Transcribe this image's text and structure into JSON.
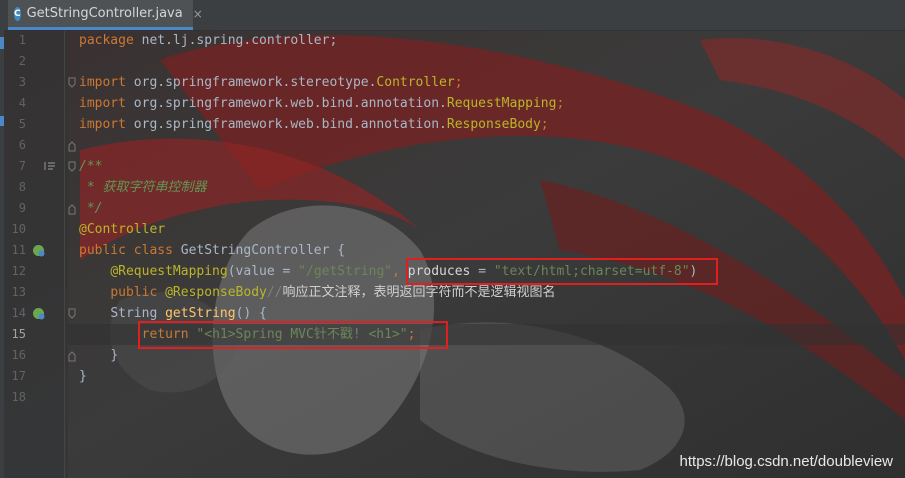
{
  "tab": {
    "icon": "C",
    "title": "GetStringController.java",
    "close": "×"
  },
  "lines": [
    {
      "n": "1"
    },
    {
      "n": "2"
    },
    {
      "n": "3"
    },
    {
      "n": "4"
    },
    {
      "n": "5"
    },
    {
      "n": "6"
    },
    {
      "n": "7"
    },
    {
      "n": "8"
    },
    {
      "n": "9"
    },
    {
      "n": "10"
    },
    {
      "n": "11"
    },
    {
      "n": "12"
    },
    {
      "n": "13"
    },
    {
      "n": "14"
    },
    {
      "n": "15"
    },
    {
      "n": "16"
    },
    {
      "n": "17"
    },
    {
      "n": "18"
    }
  ],
  "code": {
    "l1": {
      "kw": "package",
      "rest": " net.lj.spring.controller;"
    },
    "l3": {
      "kw": "import",
      "pkg": " org.springframework.stereotype.",
      "cls": "Controller",
      "semi": ";"
    },
    "l4": {
      "kw": "import",
      "pkg": " org.springframework.web.bind.annotation.",
      "cls": "RequestMapping",
      "semi": ";"
    },
    "l5": {
      "kw": "import",
      "pkg": " org.springframework.web.bind.annotation.",
      "cls": "ResponseBody",
      "semi": ";"
    },
    "l7": {
      "c": "/**"
    },
    "l8": {
      "c": " * 获取字符串控制器"
    },
    "l9": {
      "c": " */"
    },
    "l10": {
      "ann": "@Controller"
    },
    "l11": {
      "kw": "public class",
      "rest": " GetStringController {"
    },
    "l12": {
      "ann": "@RequestMapping",
      "p1": "(value = ",
      "s1": "\"/getString\"",
      "p2": ",",
      "p3": "produces",
      "p4": " = ",
      "s2": "\"text/html;charset=utf-8\"",
      "p5": ")"
    },
    "l13": {
      "kw": "public",
      "sp": " ",
      "ann": "@ResponseBody",
      "lc": "//",
      "cjk": "响应正文注释，表明返回字符而不是逻辑视图名"
    },
    "l14": {
      "type": "String",
      "sp": " ",
      "fn": "getString",
      "rest": "() {"
    },
    "l15": {
      "kw": "return",
      "sp": " ",
      "s": "\"<h1>Spring MVC针不戳! <h1>\"",
      "semi": ";"
    },
    "l16": {
      "rest": "}"
    },
    "l17": {
      "rest": "}"
    }
  },
  "watermark": "https://blog.csdn.net/doubleview",
  "colors": {
    "keyword": "#cc7832",
    "annotation": "#bbb529",
    "string": "#6a8759",
    "comment": "#629755",
    "highlight_box": "#e02020"
  }
}
